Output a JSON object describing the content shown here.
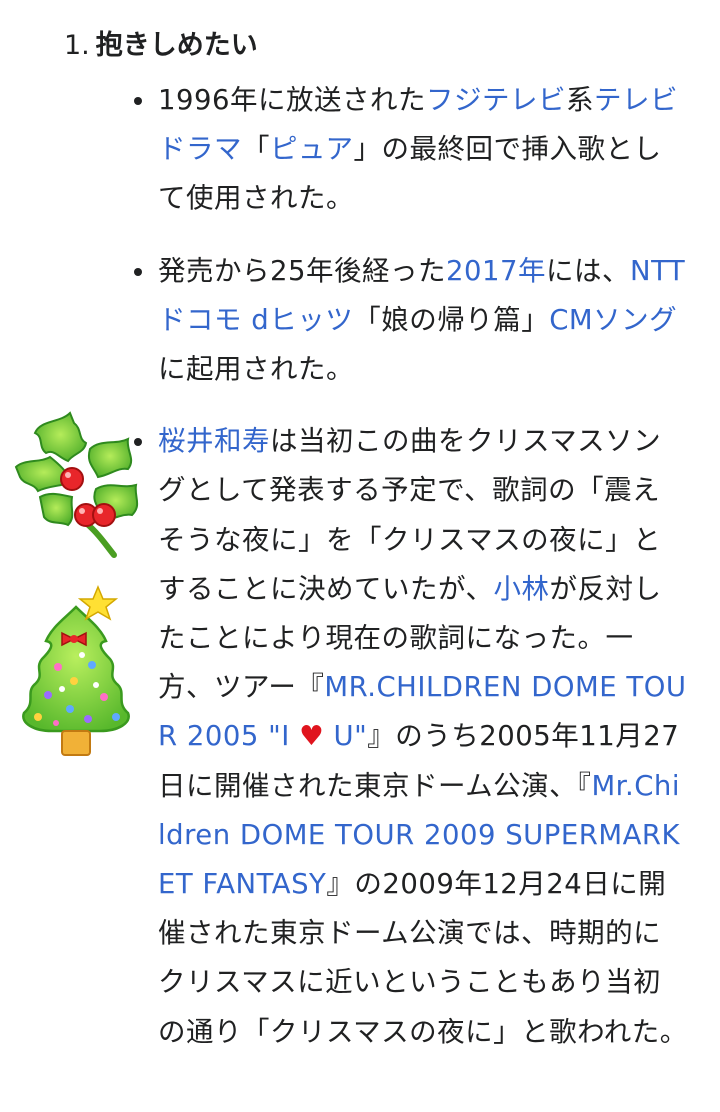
{
  "heading": {
    "number": "1.",
    "title": "抱きしめたい"
  },
  "bullets": [
    {
      "segments": [
        {
          "text": "1996年に放送された",
          "link": false
        },
        {
          "text": "フジテレビ",
          "link": true
        },
        {
          "text": "系",
          "link": false
        },
        {
          "text": "テレビドラマ",
          "link": true
        },
        {
          "text": "「",
          "link": false
        },
        {
          "text": "ピュア",
          "link": true
        },
        {
          "text": "」の最終回で挿入歌として使用された。",
          "link": false
        }
      ]
    },
    {
      "segments": [
        {
          "text": "発売から25年後経った",
          "link": false
        },
        {
          "text": "2017年",
          "link": true
        },
        {
          "text": "には、",
          "link": false
        },
        {
          "text": "NTTドコモ dヒッツ",
          "link": true
        },
        {
          "text": "「娘の帰り篇」",
          "link": false
        },
        {
          "text": "CMソング",
          "link": true
        },
        {
          "text": "に起用された。",
          "link": false
        }
      ]
    },
    {
      "segments": [
        {
          "text": "桜井和寿",
          "link": true
        },
        {
          "text": "は当初この曲をクリスマスソングとして発表する予定で、歌詞の「震えそうな夜に」を「クリスマスの夜に」とすることに決めていたが、",
          "link": false
        },
        {
          "text": "小林",
          "link": true
        },
        {
          "text": "が反対したことにより現在の歌詞になった。一方、ツアー『",
          "link": false
        },
        {
          "text": "MR.CHILDREN DOME TOUR 2005 \"I ",
          "link": true
        },
        {
          "text": "♥",
          "link": false,
          "heart": true
        },
        {
          "text": " U\"",
          "link": true
        },
        {
          "text": "』のうち2005年11月27日に開催された東京ドーム公演、『",
          "link": false
        },
        {
          "text": "Mr.Children DOME TOUR 2009 SUPERMARKET FANTASY",
          "link": true
        },
        {
          "text": "』の2009年12月24日に開催された東京ドーム公演では、時期的にクリスマスに近いということもあり当初の通り「クリスマスの夜に」と歌われた。",
          "link": false
        }
      ]
    }
  ],
  "decorations": {
    "holly": "holly-sticker",
    "tree": "christmas-tree-sticker"
  },
  "colors": {
    "link": "#3366cc",
    "text": "#202122",
    "heart": "#e0141e"
  }
}
